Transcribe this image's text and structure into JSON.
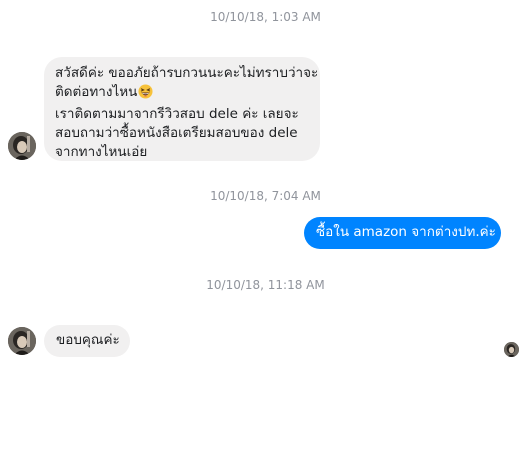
{
  "conversation": {
    "timestamps": [
      "10/10/18, 1:03 AM",
      "10/10/18, 7:04 AM",
      "10/10/18, 11:18 AM"
    ],
    "messages": [
      {
        "sender": "other",
        "lines": [
          "สวัสดีค่ะ ขออภัยถ้ารบกวนนะคะไม่ทราบว่าจะ",
          "ติดต่อทางไหน",
          "เราติดตามมาจากรีวิวสอบ dele ค่ะ เลยจะ",
          "สอบถามว่าซื้อหนังสือเตรียมสอบของ dele",
          "จากทางไหนเอ่ย"
        ],
        "emoji": "grinning-squinting-face-emoji"
      },
      {
        "sender": "self",
        "lines": [
          "ซื้อใน amazon จากต่างปท.ค่ะ"
        ]
      },
      {
        "sender": "other",
        "lines": [
          "ขอบคุณค่ะ"
        ]
      }
    ],
    "avatar_icon": "profile-photo-avatar",
    "read_receipt_icon": "seen-avatar-icon"
  },
  "colors": {
    "outgoing_bubble": "#0084ff",
    "incoming_bubble": "#f1f0f0",
    "timestamp_text": "#90949c"
  }
}
